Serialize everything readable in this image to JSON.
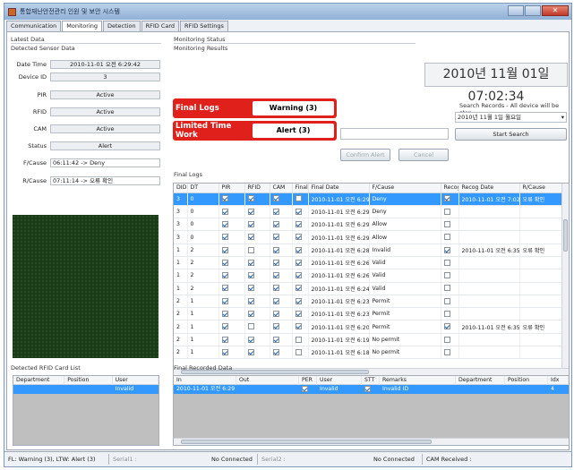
{
  "window": {
    "title": "통합재난안전관리 인원 및 보안 시스템"
  },
  "tabs": [
    "Communication",
    "Monitoring",
    "Detection",
    "RFID Card",
    "RFID Settings"
  ],
  "latest": {
    "title": "Latest Data",
    "subtitle": "Detected Sensor Data",
    "fields": [
      {
        "label": "Date Time",
        "value": "2010-11-01 오전 6:29:42"
      },
      {
        "label": "Device ID",
        "value": "3"
      },
      {
        "label": "PIR",
        "value": "Active"
      },
      {
        "label": "RFID",
        "value": "Active"
      },
      {
        "label": "CAM",
        "value": "Active"
      },
      {
        "label": "Status",
        "value": "Alert"
      },
      {
        "label": "F/Cause",
        "value": "06:11:42 -> Deny"
      },
      {
        "label": "R/Cause",
        "value": "07:11:14 -> 오류 확인"
      }
    ]
  },
  "monitoring": {
    "title": "Monitoring Status",
    "subtitle": "Monitoring Results"
  },
  "clock": "2010년 11월 01일 07:02:34",
  "alerts": [
    {
      "title": "Final Logs",
      "value": "Warning (3)"
    },
    {
      "title": "Limited Time Work",
      "value": "Alert (3)"
    }
  ],
  "buttons": {
    "confirm": "Confirm Alert",
    "cancel": "Cancel",
    "search": "Start Search"
  },
  "search": {
    "label": "Search Records - All device will be stop",
    "date": "2010년 11월  1일 월요일"
  },
  "final_logs": {
    "title": "Final Logs",
    "columns": [
      "DID",
      "DT",
      "PIR",
      "RFID",
      "CAM",
      "Final",
      "Final Date",
      "F/Cause",
      "Recog",
      "Recog Date",
      "R/Cause"
    ],
    "rows": [
      {
        "did": "3",
        "dt": "0",
        "pir": true,
        "rfid": true,
        "cam": true,
        "final": false,
        "date": "2010-11-01 오전 6:29",
        "cause": "Deny",
        "recog": true,
        "rdate": "2010-11-01 오전 7:02",
        "rcause": "오류 확인",
        "sel": true
      },
      {
        "did": "3",
        "dt": "0",
        "pir": true,
        "rfid": true,
        "cam": true,
        "final": true,
        "date": "2010-11-01 오전 6:29",
        "cause": "Deny",
        "recog": false,
        "rdate": "",
        "rcause": ""
      },
      {
        "did": "3",
        "dt": "0",
        "pir": true,
        "rfid": true,
        "cam": true,
        "final": true,
        "date": "2010-11-01 오전 6:29",
        "cause": "Allow",
        "recog": false,
        "rdate": "",
        "rcause": ""
      },
      {
        "did": "3",
        "dt": "0",
        "pir": true,
        "rfid": true,
        "cam": true,
        "final": true,
        "date": "2010-11-01 오전 6:29",
        "cause": "Allow",
        "recog": false,
        "rdate": "",
        "rcause": ""
      },
      {
        "did": "1",
        "dt": "2",
        "pir": true,
        "rfid": false,
        "cam": true,
        "final": true,
        "date": "2010-11-01 오전 6:28",
        "cause": "Invalid",
        "recog": true,
        "rdate": "2010-11-01 오전 6:35",
        "rcause": "오류 확인"
      },
      {
        "did": "1",
        "dt": "2",
        "pir": true,
        "rfid": true,
        "cam": true,
        "final": true,
        "date": "2010-11-01 오전 6:26",
        "cause": "Valid",
        "recog": false,
        "rdate": "",
        "rcause": ""
      },
      {
        "did": "1",
        "dt": "2",
        "pir": true,
        "rfid": true,
        "cam": true,
        "final": true,
        "date": "2010-11-01 오전 6:26",
        "cause": "Valid",
        "recog": false,
        "rdate": "",
        "rcause": ""
      },
      {
        "did": "1",
        "dt": "2",
        "pir": true,
        "rfid": true,
        "cam": true,
        "final": true,
        "date": "2010-11-01 오전 6:24",
        "cause": "Valid",
        "recog": false,
        "rdate": "",
        "rcause": ""
      },
      {
        "did": "2",
        "dt": "1",
        "pir": true,
        "rfid": true,
        "cam": true,
        "final": true,
        "date": "2010-11-01 오전 6:23",
        "cause": "Permit",
        "recog": false,
        "rdate": "",
        "rcause": ""
      },
      {
        "did": "2",
        "dt": "1",
        "pir": true,
        "rfid": true,
        "cam": true,
        "final": true,
        "date": "2010-11-01 오전 6:23",
        "cause": "Permit",
        "recog": false,
        "rdate": "",
        "rcause": ""
      },
      {
        "did": "2",
        "dt": "1",
        "pir": true,
        "rfid": false,
        "cam": true,
        "final": true,
        "date": "2010-11-01 오전 6:20",
        "cause": "Permit",
        "recog": true,
        "rdate": "2010-11-01 오전 6:35",
        "rcause": "오류 확인"
      },
      {
        "did": "2",
        "dt": "1",
        "pir": true,
        "rfid": true,
        "cam": true,
        "final": false,
        "date": "2010-11-01 오전 6:19",
        "cause": "No permit",
        "recog": false,
        "rdate": "",
        "rcause": ""
      },
      {
        "did": "2",
        "dt": "1",
        "pir": true,
        "rfid": true,
        "cam": true,
        "final": false,
        "date": "2010-11-01 오전 6:18",
        "cause": "No permit",
        "recog": false,
        "rdate": "",
        "rcause": ""
      }
    ]
  },
  "rfid_list": {
    "title": "Detected RFID Card List",
    "columns": [
      "Department",
      "Position",
      "User"
    ],
    "rows": [
      {
        "department": "",
        "position": "",
        "user": "Invalid"
      }
    ]
  },
  "recorded": {
    "title": "Final Recorded Data",
    "columns": [
      "In",
      "Out",
      "PER",
      "User",
      "STT",
      "Remarks",
      "Department",
      "Position",
      "Idx"
    ],
    "rows": [
      {
        "in": "2010-11-01 오전 6:29",
        "out": "",
        "per": true,
        "user": "Invalid",
        "stt": true,
        "remarks": "Invalid ID",
        "department": "",
        "position": "",
        "idx": "4"
      }
    ]
  },
  "statusbar": {
    "left": "FL: Warning (3), LTW: Alert (3)",
    "serial1": "Serial1 :",
    "serial1_state": "No Connected",
    "serial2": "Serial2 :",
    "serial2_state": "No Connected",
    "cam": "CAM Received :"
  }
}
